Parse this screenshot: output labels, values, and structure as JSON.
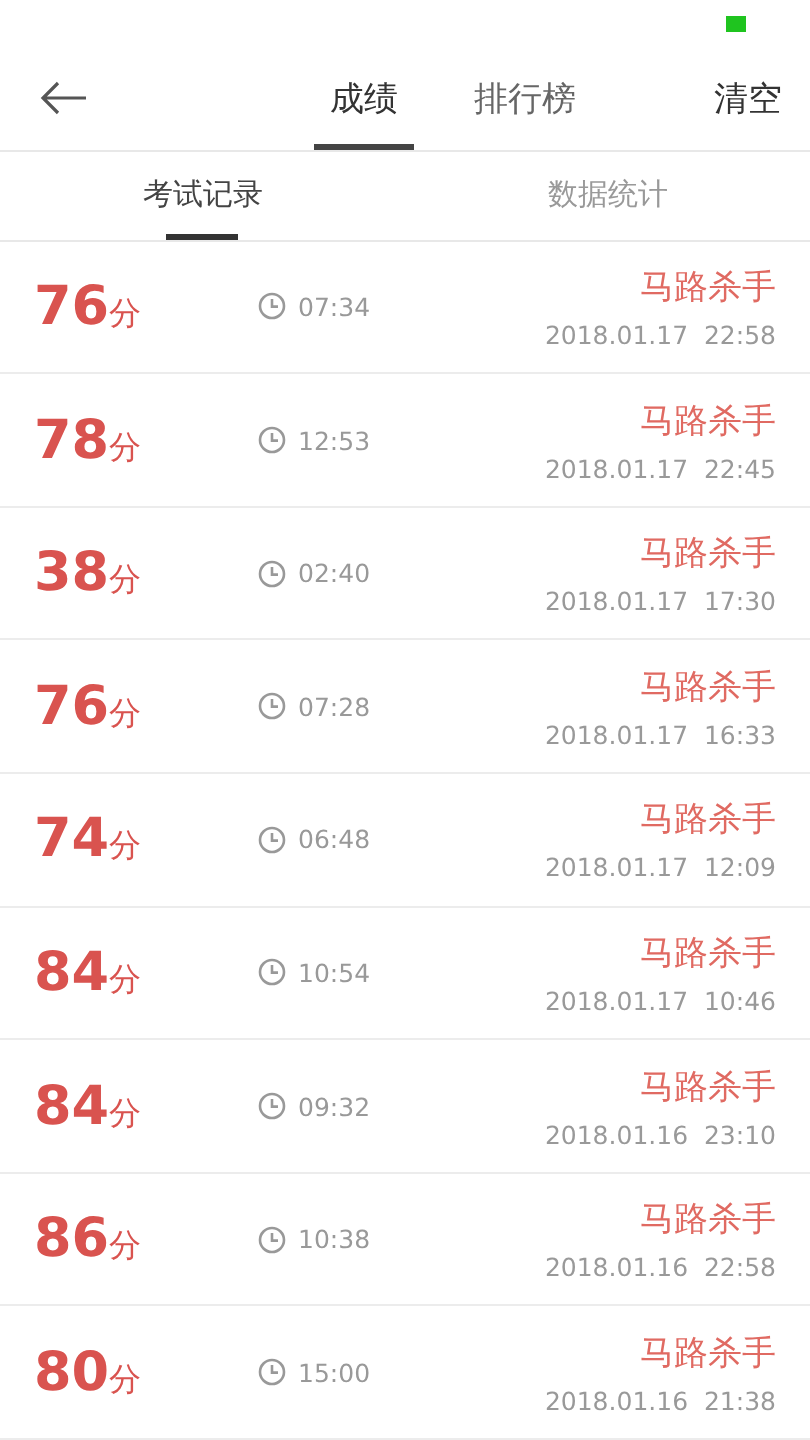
{
  "header": {
    "tabs": [
      {
        "label": "成绩",
        "selected": true
      },
      {
        "label": "排行榜",
        "selected": false
      }
    ],
    "action": "清空"
  },
  "subtabs": [
    {
      "label": "考试记录",
      "selected": true
    },
    {
      "label": "数据统计",
      "selected": false
    }
  ],
  "records": [
    {
      "score": "76",
      "unit": "分",
      "duration": "07:34",
      "title": "马路杀手",
      "date": "2018.01.17  22:58"
    },
    {
      "score": "78",
      "unit": "分",
      "duration": "12:53",
      "title": "马路杀手",
      "date": "2018.01.17  22:45"
    },
    {
      "score": "38",
      "unit": "分",
      "duration": "02:40",
      "title": "马路杀手",
      "date": "2018.01.17  17:30"
    },
    {
      "score": "76",
      "unit": "分",
      "duration": "07:28",
      "title": "马路杀手",
      "date": "2018.01.17  16:33"
    },
    {
      "score": "74",
      "unit": "分",
      "duration": "06:48",
      "title": "马路杀手",
      "date": "2018.01.17  12:09"
    },
    {
      "score": "84",
      "unit": "分",
      "duration": "10:54",
      "title": "马路杀手",
      "date": "2018.01.17  10:46"
    },
    {
      "score": "84",
      "unit": "分",
      "duration": "09:32",
      "title": "马路杀手",
      "date": "2018.01.16  23:10"
    },
    {
      "score": "86",
      "unit": "分",
      "duration": "10:38",
      "title": "马路杀手",
      "date": "2018.01.16  22:58"
    },
    {
      "score": "80",
      "unit": "分",
      "duration": "15:00",
      "title": "马路杀手",
      "date": "2018.01.16  21:38"
    }
  ]
}
